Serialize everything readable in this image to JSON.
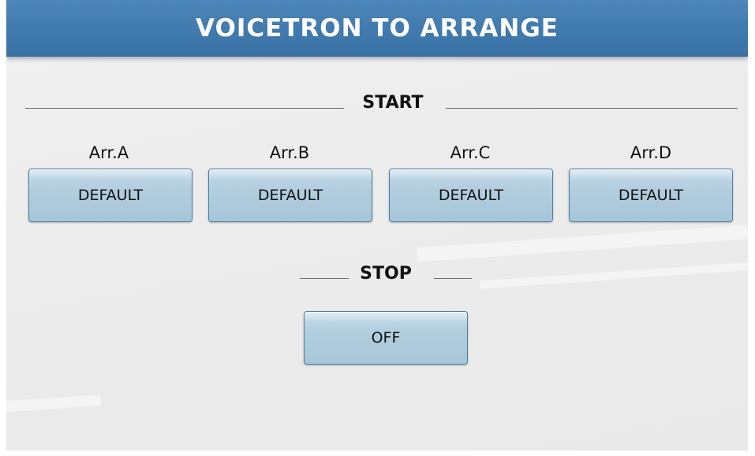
{
  "header": {
    "title": "VOICETRON TO ARRANGE"
  },
  "start_section": {
    "heading": "START",
    "arrangements": [
      {
        "label": "Arr.A",
        "value": "DEFAULT"
      },
      {
        "label": "Arr.B",
        "value": "DEFAULT"
      },
      {
        "label": "Arr.C",
        "value": "DEFAULT"
      },
      {
        "label": "Arr.D",
        "value": "DEFAULT"
      }
    ]
  },
  "stop_section": {
    "heading": "STOP",
    "value": "OFF"
  },
  "colors": {
    "title_bar": "#3f79ad",
    "button_fill": "#b3cfdf",
    "button_border": "#4d7ea8",
    "background": "#ececec"
  }
}
